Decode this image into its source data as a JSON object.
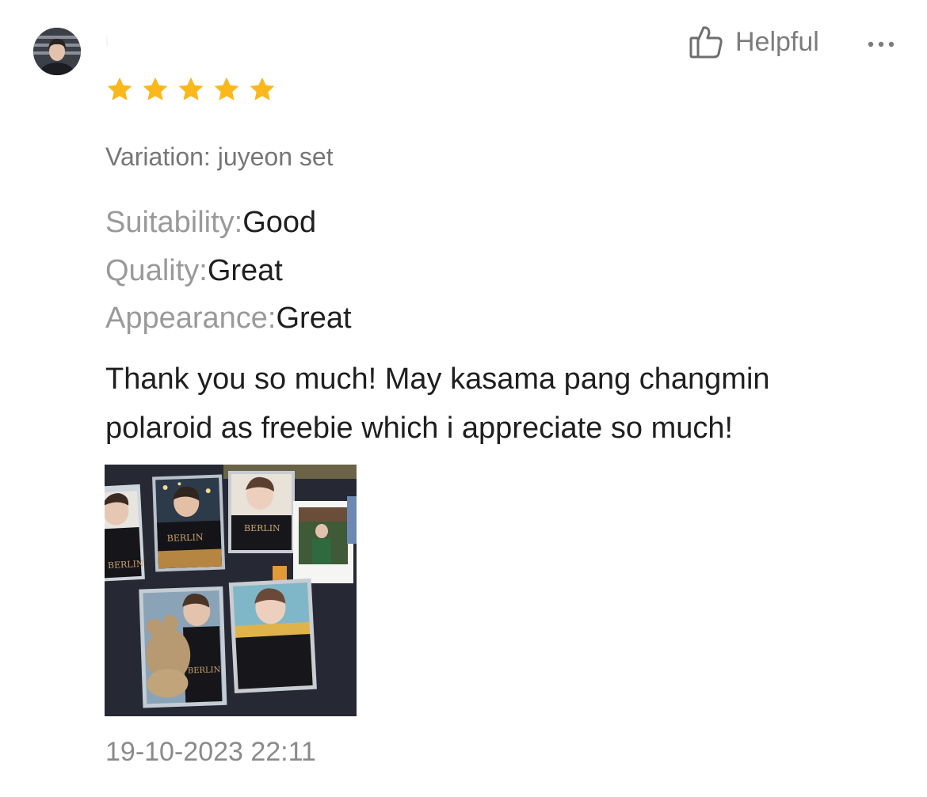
{
  "review": {
    "reviewer": {
      "avatar_icon": "user-avatar-icon",
      "name": "l"
    },
    "rating": 5,
    "helpful_label": "Helpful",
    "thumbs_icon": "thumbs-up-icon",
    "more_icon": "more-dots-icon",
    "variation": "Variation: juyeon set",
    "attributes": [
      {
        "key": "Suitability:",
        "value": "Good"
      },
      {
        "key": "Quality:",
        "value": "Great"
      },
      {
        "key": "Appearance:",
        "value": "Great"
      }
    ],
    "comment_lines": [
      "Thank you so much! May kasama pang changmin",
      "polaroid as freebie which i appreciate so much!"
    ],
    "photo": {
      "card_texts": [
        "BERLIN",
        "BERLIN",
        "BERLIN",
        "BERLIN"
      ]
    },
    "timestamp": "19-10-2023 22:11",
    "colors": {
      "star": "#fbb81c",
      "label_gray": "#9a9a9a",
      "text_dark": "#1f1f1f",
      "muted": "#767676"
    }
  }
}
